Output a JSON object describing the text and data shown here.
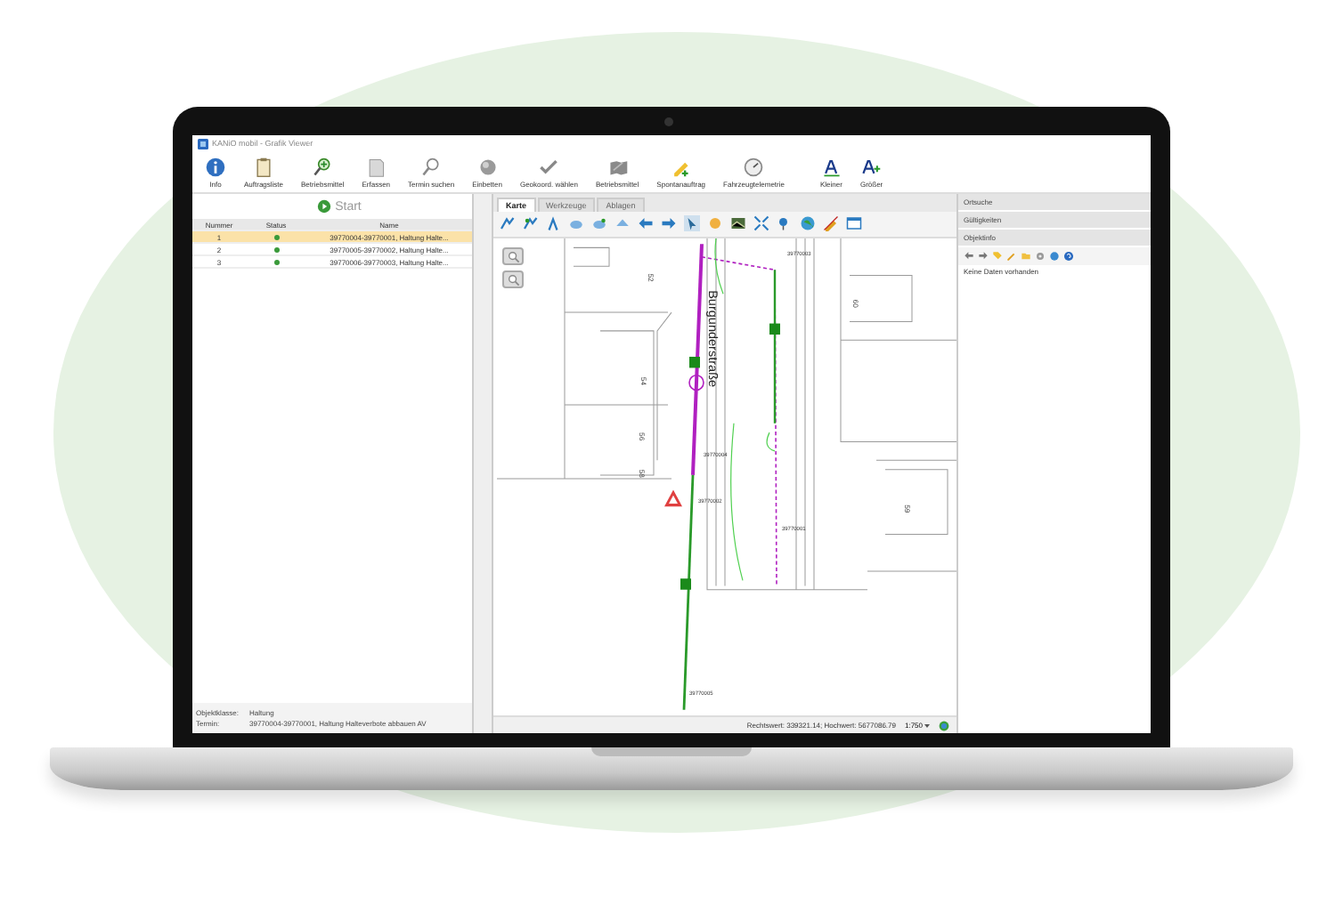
{
  "window": {
    "title": "KANiO mobil - Grafik Viewer"
  },
  "toolbar": [
    {
      "label": "Info"
    },
    {
      "label": "Auftragsliste"
    },
    {
      "label": "Betriebsmittel"
    },
    {
      "label": "Erfassen"
    },
    {
      "label": "Termin suchen"
    },
    {
      "label": "Einbetten"
    },
    {
      "label": "Geokoord. wählen"
    },
    {
      "label": "Betriebsmittel"
    },
    {
      "label": "Spontanauftrag"
    },
    {
      "label": "Fahrzeugtelemetrie"
    },
    {
      "label": "Kleiner"
    },
    {
      "label": "Größer"
    }
  ],
  "left_panel": {
    "start_button": "Start",
    "table": {
      "columns": [
        "Nummer",
        "Status",
        "Name"
      ],
      "rows": [
        {
          "number": "1",
          "name": "39770004-39770001, Haltung Halte...",
          "selected": true
        },
        {
          "number": "2",
          "name": "39770005-39770002, Haltung Halte...",
          "selected": false
        },
        {
          "number": "3",
          "name": "39770006-39770003, Haltung Halte...",
          "selected": false
        }
      ]
    },
    "info": [
      {
        "label": "Objektklasse:",
        "value": "Haltung"
      },
      {
        "label": "Termin:",
        "value": "39770004-39770001, Haltung Halteverbote abbauen AV"
      }
    ]
  },
  "map_tabs": [
    {
      "label": "Karte",
      "selected": true
    },
    {
      "label": "Werkzeuge",
      "selected": false
    },
    {
      "label": "Ablagen",
      "selected": false
    }
  ],
  "map": {
    "street_label": "Burgunderstraße",
    "parcel_numbers": [
      "52",
      "54",
      "56",
      "58",
      "60",
      "59"
    ],
    "node_labels": [
      "39770003",
      "39770004",
      "39770002",
      "39770001",
      "39770005"
    ]
  },
  "status_bar": {
    "coordinates": "Rechtswert: 339321.14; Hochwert: 5677086.79",
    "scale": "1:750"
  },
  "right_panel": {
    "sections": [
      "Ortsuche",
      "Gültigkeiten",
      "Objektinfo"
    ],
    "message": "Keine Daten vorhanden"
  }
}
